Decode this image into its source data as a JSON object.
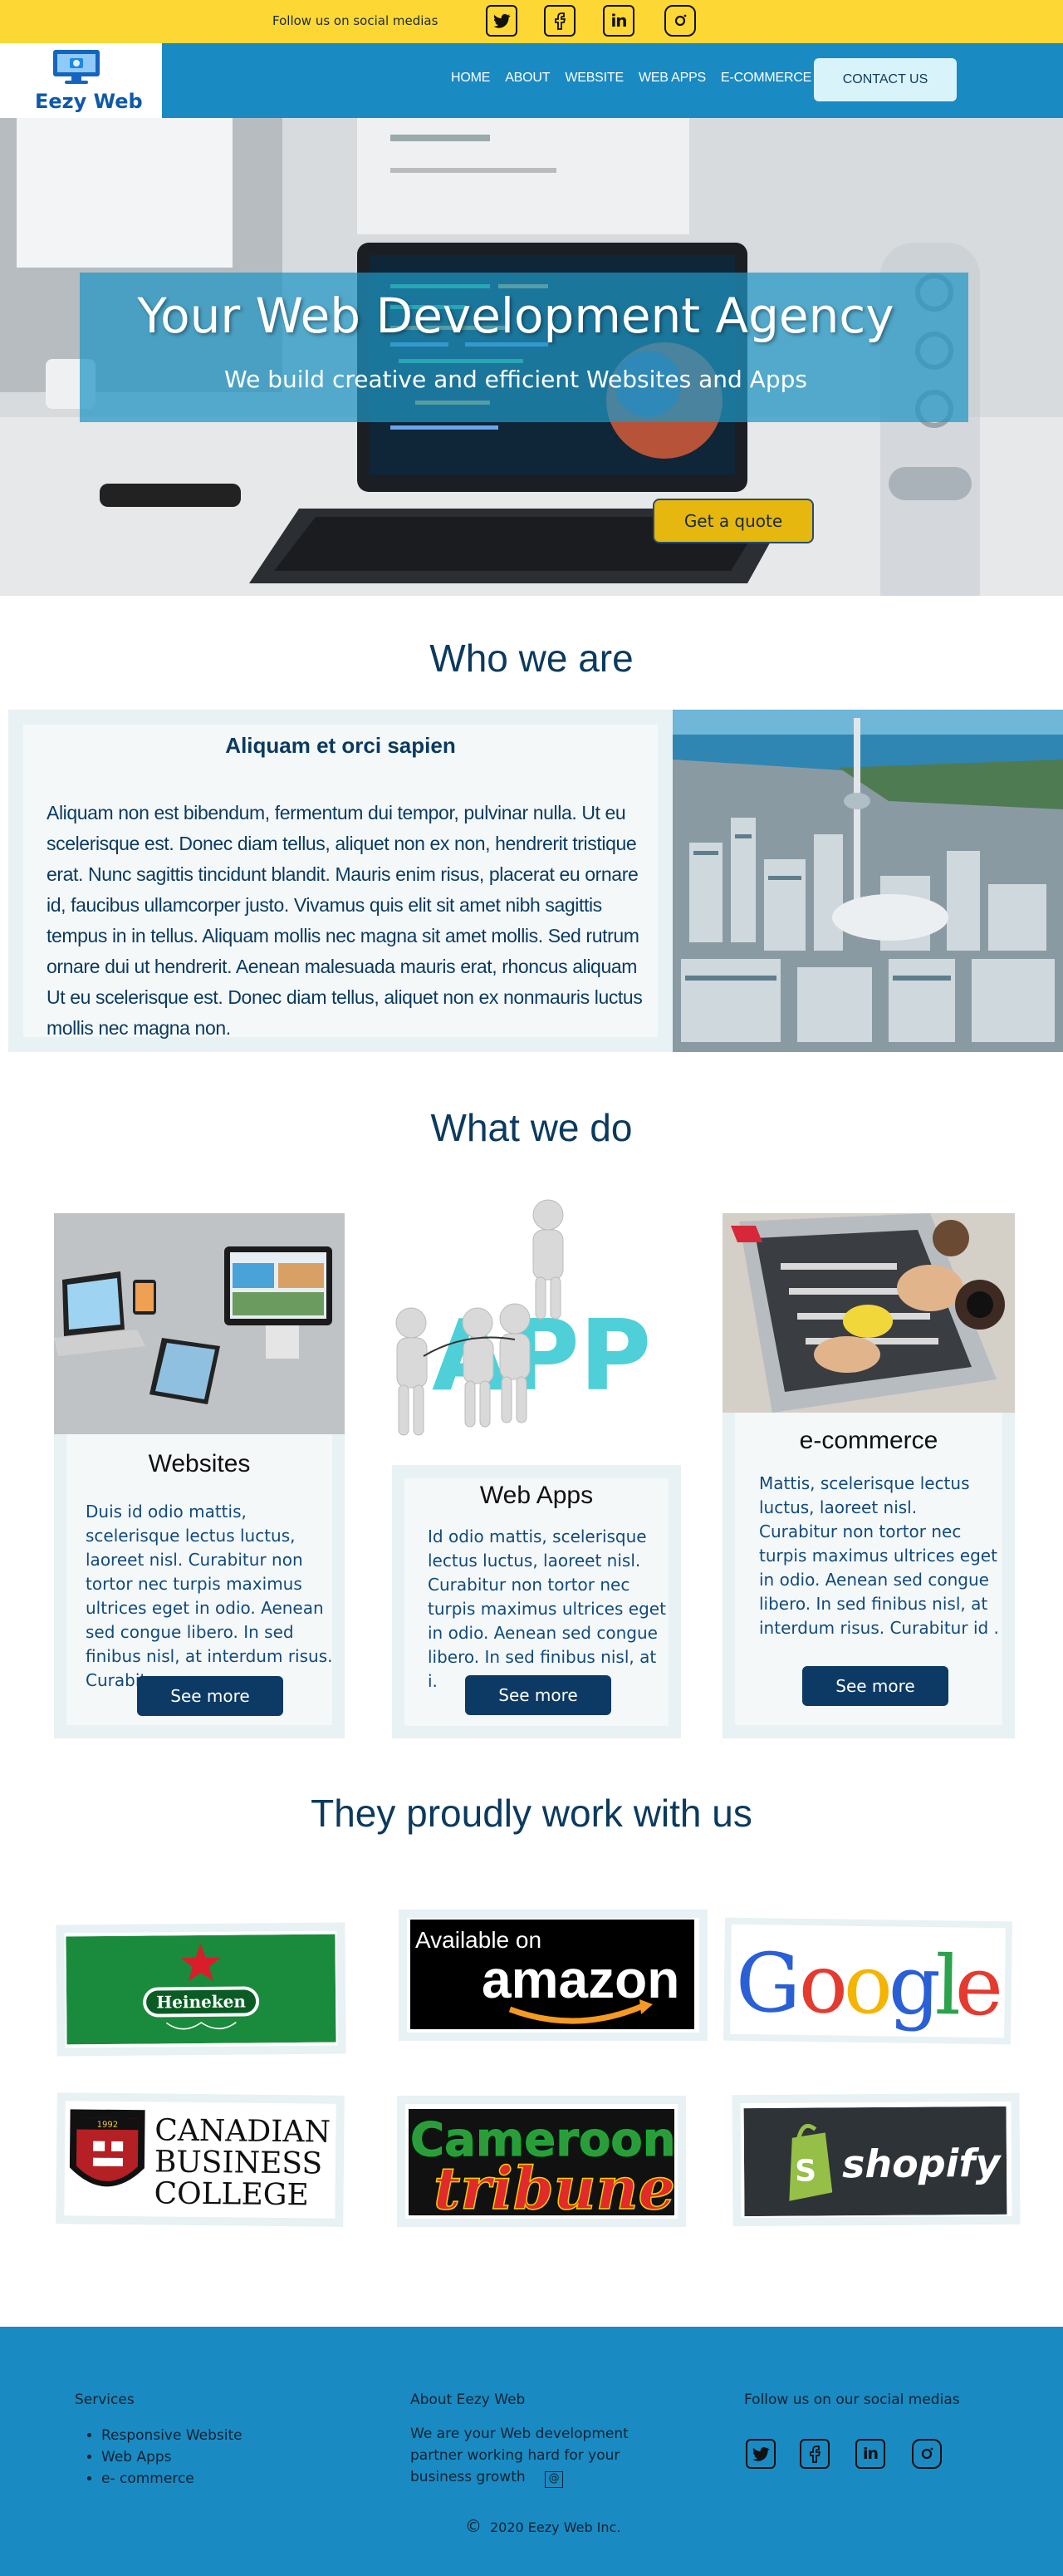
{
  "topbar": {
    "follow_text": "Follow us on  social medias",
    "icons": [
      "twitter-icon",
      "facebook-icon",
      "linkedin-icon",
      "instagram-icon"
    ]
  },
  "nav": {
    "brand": "Eezy Web",
    "links": [
      "HOME",
      "ABOUT",
      "WEBSITE",
      "WEB APPS",
      "E-COMMERCE"
    ],
    "contact": "CONTACT US"
  },
  "hero": {
    "title": "Your Web Development Agency",
    "subtitle": "We build creative and efficient Websites and Apps",
    "cta": "Get a quote"
  },
  "who": {
    "title": "Who we are",
    "heading": "Aliquam et orci sapien",
    "body": "Aliquam non est bibendum, fermentum dui tempor, pulvinar nulla. Ut eu scelerisque est. Donec diam tellus, aliquet non ex non, hendrerit tristique erat. Nunc sagittis tincidunt blandit. Mauris enim risus, placerat eu ornare id, faucibus ullamcorper justo. Vivamus quis elit sit amet nibh sagittis tempus in in tellus. Aliquam mollis nec magna sit amet mollis. Sed rutrum ornare dui ut hendrerit. Aenean malesuada mauris erat, rhoncus aliquam Ut eu scelerisque est. Donec diam tellus, aliquet non ex nonmauris luctus  mollis nec magna non."
  },
  "services": {
    "title": "What we do",
    "cards": [
      {
        "title": "Websites",
        "text": "Duis id odio mattis, scelerisque lectus luctus, laoreet nisl. Curabitur non tortor nec turpis maximus ultrices eget in odio. Aenean sed congue libero. In sed finibus nisl, at interdum risus. Curabitu.",
        "button": "See more"
      },
      {
        "title": "Web Apps",
        "text": "Id odio mattis, scelerisque lectus luctus, laoreet nisl. Curabitur non tortor nec turpis maximus ultrices eget in odio. Aenean sed congue libero. In sed finibus nisl, at i.",
        "button": "See more",
        "art_text": "APP"
      },
      {
        "title": "e-commerce",
        "text": "Mattis, scelerisque lectus luctus, laoreet nisl. Curabitur non tortor nec turpis maximus ultrices eget in odio. Aenean sed congue libero. In sed finibus nisl, at interdum risus. Curabitur id .",
        "button": "See more"
      }
    ]
  },
  "partners": {
    "title": "They proudly work with us",
    "logos": [
      {
        "name": "Heineken",
        "text": "Heineken"
      },
      {
        "name": "amazon",
        "text_top": "Available on",
        "text": "amazon"
      },
      {
        "name": "Google",
        "letters": [
          "G",
          "o",
          "o",
          "g",
          "l",
          "e"
        ]
      },
      {
        "name": "Canadian Business College",
        "lines": [
          "CANADIAN",
          "BUSINESS",
          "COLLEGE"
        ],
        "year": "1992"
      },
      {
        "name": "Cameroon tribune",
        "line1": "Cameroon",
        "line2": "tribune"
      },
      {
        "name": "shopify",
        "text": "shopify"
      }
    ]
  },
  "footer": {
    "services_title": "Services",
    "services": [
      "Responsive Website",
      "Web Apps",
      "e- commerce"
    ],
    "about_title": "About Eezy Web",
    "about_text": "We are your Web development partner working hard for your business growth",
    "follow_title": "Follow  us on our social medias",
    "copyright": "2020 Eezy Web Inc."
  },
  "colors": {
    "topbar": "#fdd835",
    "nav": "#1a8ac2",
    "accent_dark": "#0d3a64",
    "cta": "#e6b70e"
  }
}
